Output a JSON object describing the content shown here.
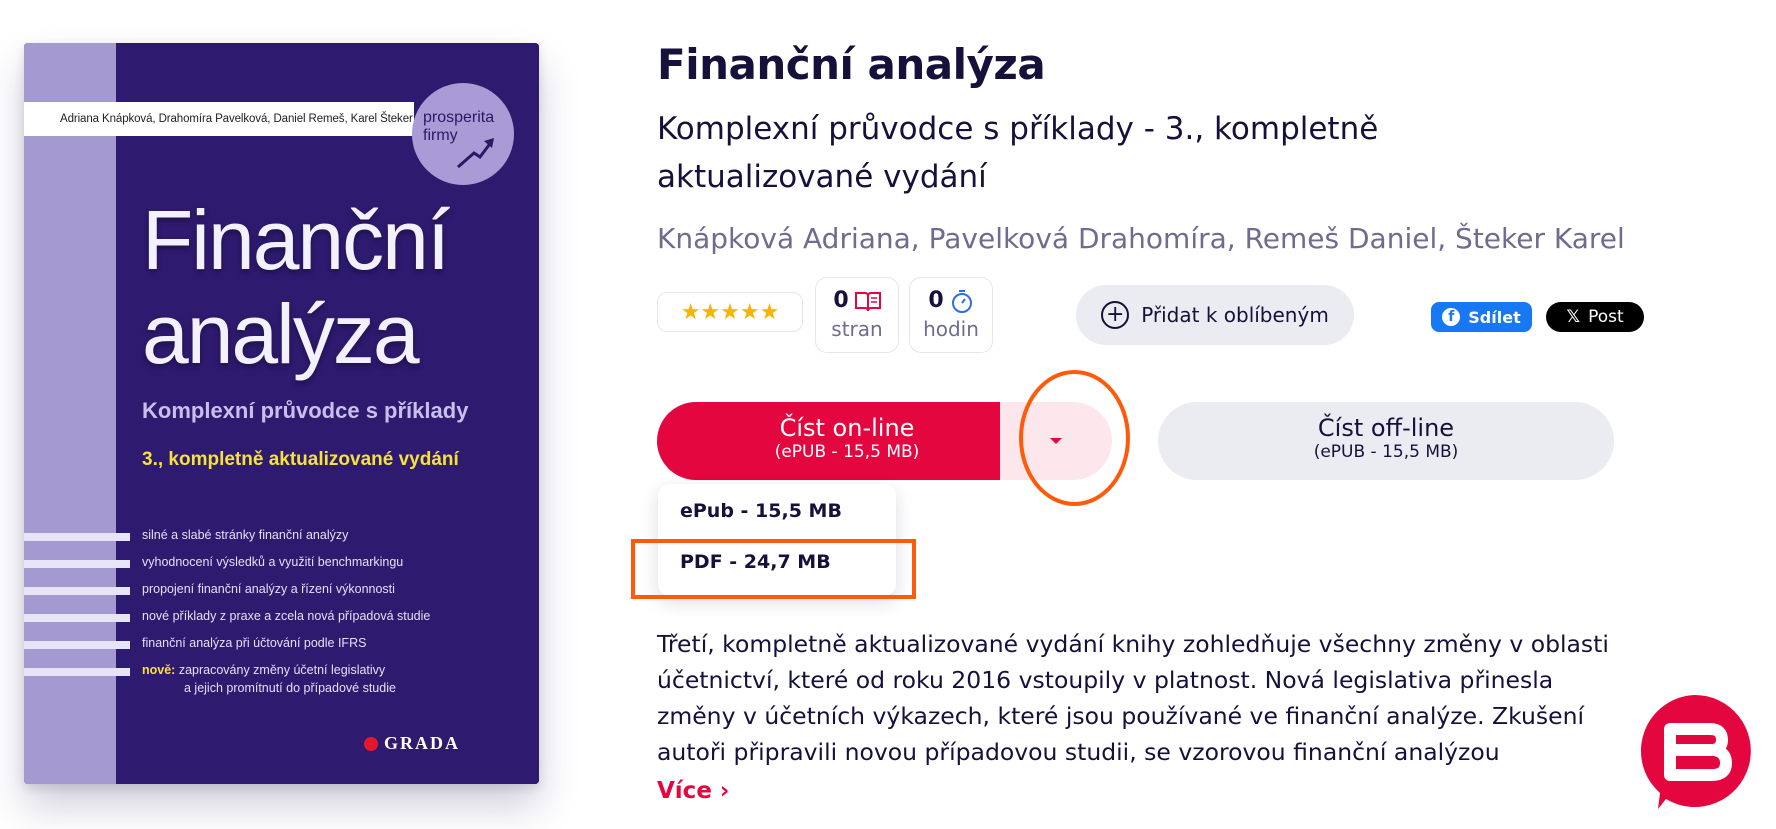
{
  "cover": {
    "authors": "Adriana Knápková, Drahomíra Pavelková, Daniel Remeš, Karel Šteker",
    "badge_line1": "prosperita",
    "badge_line2": "firmy",
    "title_line1": "Finanční",
    "title_line2": "analýza",
    "subtitle": "Komplexní průvodce s příklady",
    "edition": "3., kompletně aktualizované vydání",
    "bullets": [
      "silné a slabé stránky finanční analýzy",
      "vyhodnocení výsledků a využití benchmarkingu",
      "propojení finanční analýzy a řízení výkonnosti",
      "nové příklady z praxe a zcela nová případová studie",
      "finanční analýza při účtování podle IFRS"
    ],
    "nove_label": "nově:",
    "nove_line1": "zapracovány změny účetní legislativy",
    "nove_line2": "a jejich promítnutí do případové studie",
    "publisher": "GRADA"
  },
  "book": {
    "title": "Finanční analýza",
    "subtitle": "Komplexní průvodce s příklady - 3., kompletně aktualizované vydání",
    "authors": "Knápková Adriana, Pavelková Drahomíra, Remeš Daniel, Šteker Karel",
    "rating_stars": "★★★★★",
    "pages_value": "0",
    "pages_label": "stran",
    "hours_value": "0",
    "hours_label": "hodin"
  },
  "actions": {
    "favorite": "Přidat k oblíbeným",
    "share_facebook": "Sdílet",
    "share_x": "Post",
    "read_online": "Číst on-line",
    "read_online_sub": "(ePUB - 15,5 MB)",
    "read_offline": "Číst off-line",
    "read_offline_sub": "(ePUB - 15,5 MB)"
  },
  "dropdown": {
    "items": [
      "ePub - 15,5 MB",
      "PDF - 24,7 MB"
    ]
  },
  "description": {
    "text": "Třetí, kompletně aktualizované vydání knihy zohledňuje všechny změny v oblasti účetnictví, které od roku 2016 vstoupily v platnost. Nová legislativa přinesla změny v účetních výkazech, které jsou používané ve finanční analýze. Zkušení autoři připravili novou případovou studii, se vzorovou finanční analýzou",
    "more": "Více ›"
  },
  "colors": {
    "accent": "#e4063f",
    "highlight": "#ff5a0a",
    "cover_bg": "#2e1a6f"
  }
}
